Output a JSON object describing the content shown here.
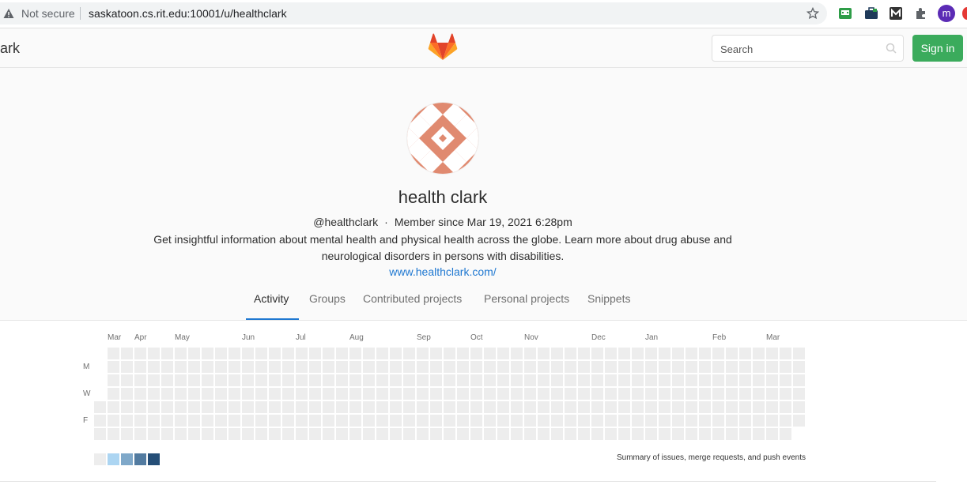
{
  "browser": {
    "security_label": "Not secure",
    "url": "saskatoon.cs.rit.edu:10001/u/healthclark",
    "profile_initial": "m",
    "icons": [
      "warning-icon",
      "star-icon",
      "extension-icon",
      "puzzle-icon",
      "profile-avatar"
    ]
  },
  "header": {
    "title_fragment": "ark",
    "search_placeholder": "Search",
    "sign_in_label": "Sign in"
  },
  "profile": {
    "name": "health clark",
    "username": "@healthclark",
    "separator": "·",
    "member_since": "Member since Mar 19, 2021 6:28pm",
    "bio_line1": "Get insightful information about mental health and physical health across the globe. Learn more about drug abuse and",
    "bio_line2": "neurological disorders in persons with disabilities.",
    "website": "www.healthclark.com/"
  },
  "tabs": [
    {
      "label": "Activity",
      "active": true
    },
    {
      "label": "Groups",
      "active": false
    },
    {
      "label": "Contributed projects",
      "active": false
    },
    {
      "label": "Personal projects",
      "active": false
    },
    {
      "label": "Snippets",
      "active": false
    }
  ],
  "calendar": {
    "months": [
      "Mar",
      "Apr",
      "May",
      "Jun",
      "Jul",
      "Aug",
      "Sep",
      "Oct",
      "Nov",
      "Dec",
      "Jan",
      "Feb",
      "Mar"
    ],
    "day_labels": [
      "M",
      "W",
      "F"
    ],
    "legend_colors": [
      "#ededed",
      "#acd5f2",
      "#7fa8c9",
      "#527ba0",
      "#254e77"
    ],
    "summary": "Summary of issues, merge requests, and push events"
  },
  "colors": {
    "accent": "#1f78d1",
    "sign_in": "#3bab5c",
    "avatar": "#e08a70"
  }
}
